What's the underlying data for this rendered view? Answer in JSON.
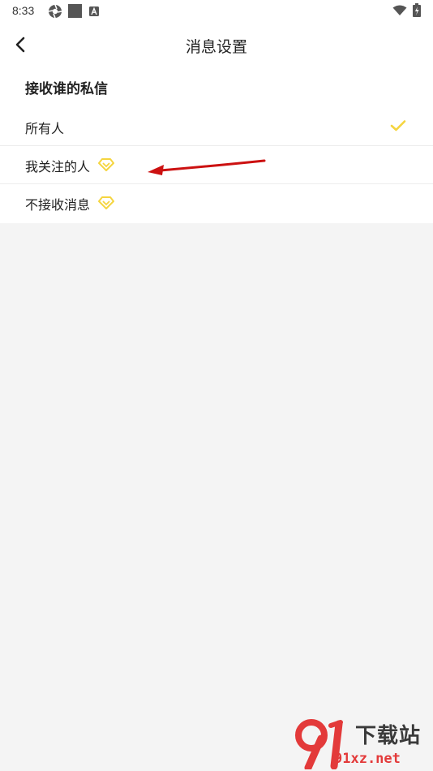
{
  "status_bar": {
    "time": "8:33"
  },
  "header": {
    "title": "消息设置"
  },
  "section": {
    "title": "接收谁的私信"
  },
  "options": [
    {
      "label": "所有人",
      "selected": true,
      "vip": false
    },
    {
      "label": "我关注的人",
      "selected": false,
      "vip": true
    },
    {
      "label": "不接收消息",
      "selected": false,
      "vip": true
    }
  ],
  "colors": {
    "accent": "#f5d540",
    "annotation_arrow": "#cc1111",
    "background": "#f4f4f4",
    "watermark_red": "#e33a3a"
  },
  "icons": {
    "back": "chevron-left-icon",
    "check": "check-icon",
    "vip": "diamond-icon"
  },
  "watermark": {
    "brand": "下载站",
    "url": "91xz.net"
  }
}
